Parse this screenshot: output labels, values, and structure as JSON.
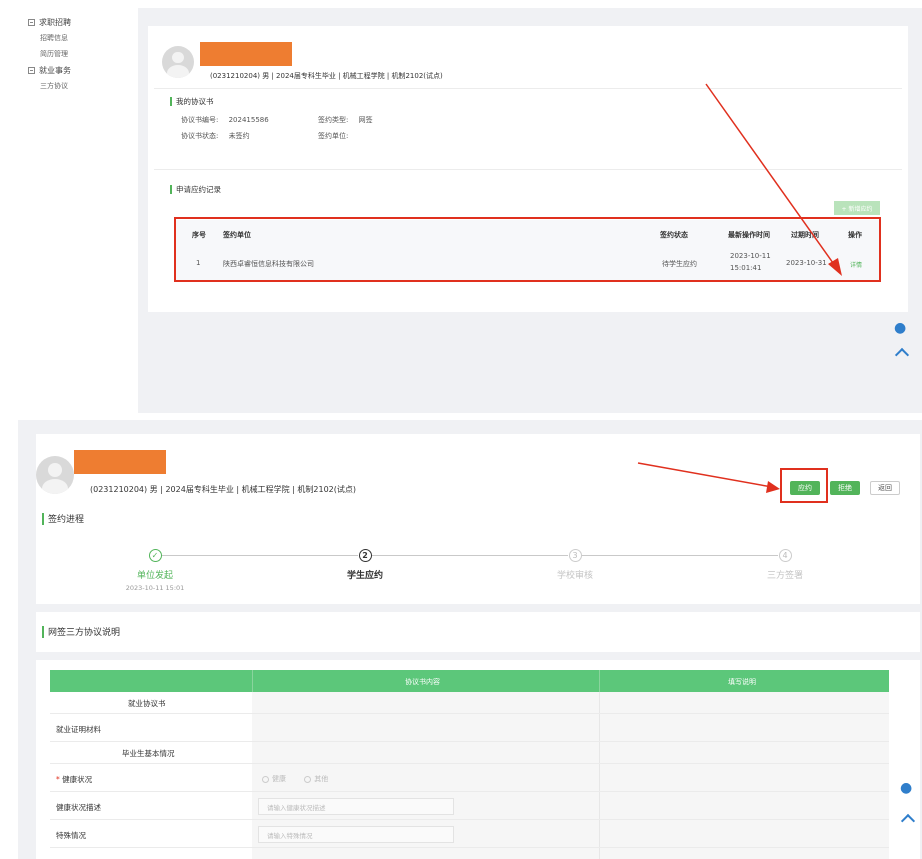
{
  "top_view": {
    "menu": [
      {
        "label": "求职招聘",
        "children": [
          "招聘信息",
          "简历管理"
        ]
      },
      {
        "label": "就业事务",
        "children": [
          "三方协议"
        ]
      }
    ],
    "student": {
      "info": "(0231210204) 男 | 2024届专科生毕业 | 机械工程学院 | 机制2102(试点)"
    },
    "agreement": {
      "section_title": "我的协议书",
      "no_label": "协议书编号:",
      "no_value": "202415586",
      "type_label": "签约类型:",
      "type_value": "网签",
      "status_label": "协议书状态:",
      "status_value": "未签约",
      "unit_label": "签约单位:",
      "unit_value": ""
    },
    "records": {
      "section_title": "申请应约记录",
      "add_button": "+ 新增应约",
      "headers": [
        "序号",
        "签约单位",
        "签约状态",
        "最新操作时间",
        "过期时间",
        "操作"
      ],
      "rows": [
        {
          "index": "1",
          "unit": "陕西卓睿恒信息科技有限公司",
          "status": "待学生应约",
          "latest_date": "2023-10-11",
          "latest_time": "15:01:41",
          "expire": "2023-10-31",
          "action": "详情"
        }
      ]
    }
  },
  "bottom_view": {
    "student": {
      "info": "(0231210204) 男 | 2024届专科生毕业 | 机械工程学院 | 机制2102(试点)"
    },
    "buttons": {
      "apply": "应约",
      "reject": "拒绝",
      "back": "返回"
    },
    "progress": {
      "title": "签约进程",
      "steps": [
        {
          "label": "单位发起",
          "time": "2023-10-11 15:01",
          "state": "done",
          "mark": "✓"
        },
        {
          "label": "学生应约",
          "time": "",
          "state": "active",
          "mark": "2"
        },
        {
          "label": "学校审核",
          "time": "",
          "state": "pending",
          "mark": "3"
        },
        {
          "label": "三方签署",
          "time": "",
          "state": "pending",
          "mark": "4"
        }
      ]
    },
    "explain_title": "网签三方协议说明",
    "table": {
      "headers": [
        "",
        "协议书内容",
        "填写说明"
      ],
      "rows": [
        {
          "label": "就业协议书",
          "type": "group"
        },
        {
          "label": "就业证明材料",
          "type": "field"
        },
        {
          "label": "毕业生基本情况",
          "type": "group"
        },
        {
          "label": "健康状况",
          "type": "radio",
          "required": true,
          "options": [
            "健康",
            "其他"
          ]
        },
        {
          "label": "健康状况描述",
          "type": "input",
          "placeholder": "请输入健康状况描述"
        },
        {
          "label": "特殊情况",
          "type": "input",
          "placeholder": "请输入特殊情况"
        }
      ]
    }
  },
  "colors": {
    "green": "#52b45a",
    "table_green": "#5cc77a",
    "orange": "#ee7d31",
    "annotation_red": "#e0301e",
    "icon_blue": "#2f7ecb"
  }
}
